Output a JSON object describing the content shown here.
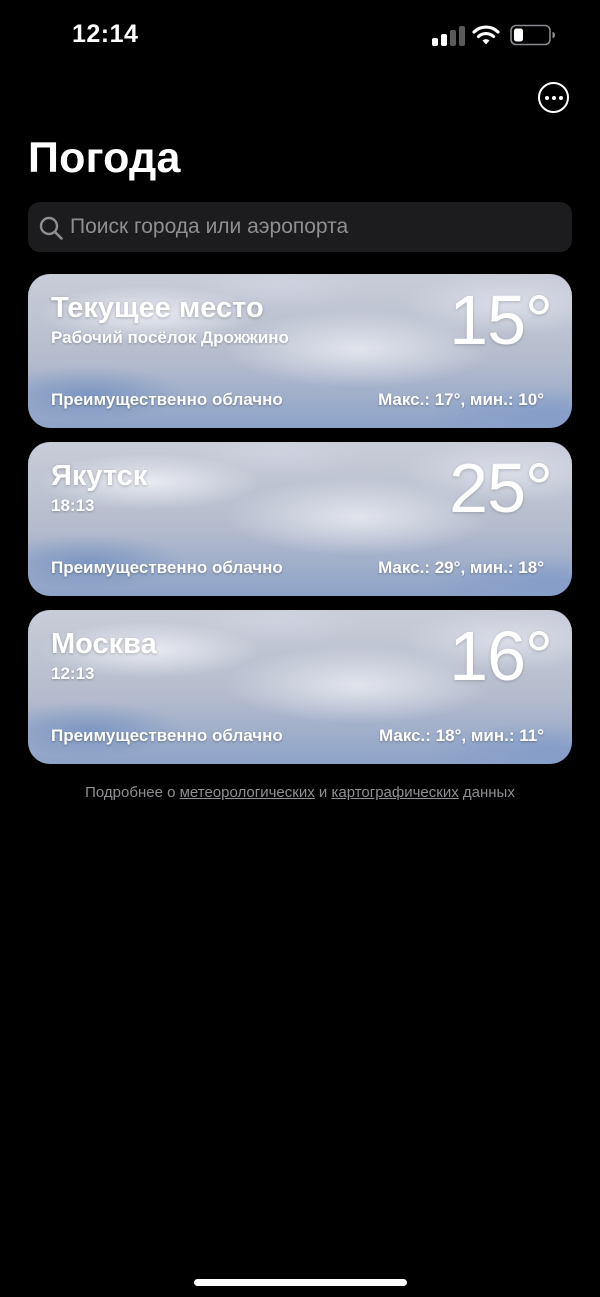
{
  "status_bar": {
    "time": "12:14",
    "signal_bars_active": 2,
    "signal_bars_total": 4,
    "battery_level": 0.25,
    "icons": [
      "signal-icon",
      "wifi-icon",
      "battery-icon"
    ]
  },
  "header": {
    "title": "Погода",
    "more_icon": "ellipsis-circle-icon"
  },
  "search": {
    "placeholder": "Поиск города или аэропорта",
    "value": "",
    "icon": "magnifier-icon"
  },
  "cities": [
    {
      "title": "Текущее место",
      "subtitle": "Рабочий посёлок Дрожжино",
      "temperature": "15°",
      "condition": "Преимущественно облачно",
      "range": "Макс.: 17°, мин.: 10°"
    },
    {
      "title": "Якутск",
      "subtitle": "18:13",
      "temperature": "25°",
      "condition": "Преимущественно облачно",
      "range": "Макс.: 29°, мин.: 18°"
    },
    {
      "title": "Москва",
      "subtitle": "12:13",
      "temperature": "16°",
      "condition": "Преимущественно облачно",
      "range": "Макс.: 18°, мин.: 11°"
    }
  ],
  "footer": {
    "prefix": "Подробнее о ",
    "weather_link": "метеорологических",
    "conjunction": " и ",
    "map_link": "картографических",
    "suffix": " данных"
  },
  "colors": {
    "background": "#000000",
    "search_background": "#1c1c1e",
    "secondary_text": "#8e8e93"
  }
}
